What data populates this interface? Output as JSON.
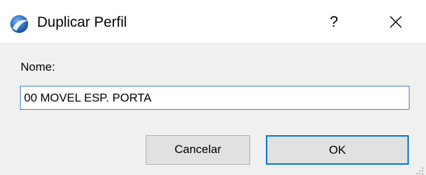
{
  "window": {
    "title": "Duplicar Perfil",
    "help_glyph": "?",
    "close_glyph": "close"
  },
  "form": {
    "name_label": "Nome:",
    "name_value": "00 MOVEL ESP. PORTA"
  },
  "buttons": {
    "cancel_label": "Cancelar",
    "ok_label": "OK"
  },
  "icons": {
    "app": "archicad-logo-icon",
    "help": "help-icon",
    "close": "close-icon",
    "resize": "resize-grip-icon"
  },
  "colors": {
    "accent": "#0078d7",
    "input_border": "#3c7fd6",
    "button_face": "#e1e1e1",
    "dialog_bg": "#f0f0f0"
  }
}
